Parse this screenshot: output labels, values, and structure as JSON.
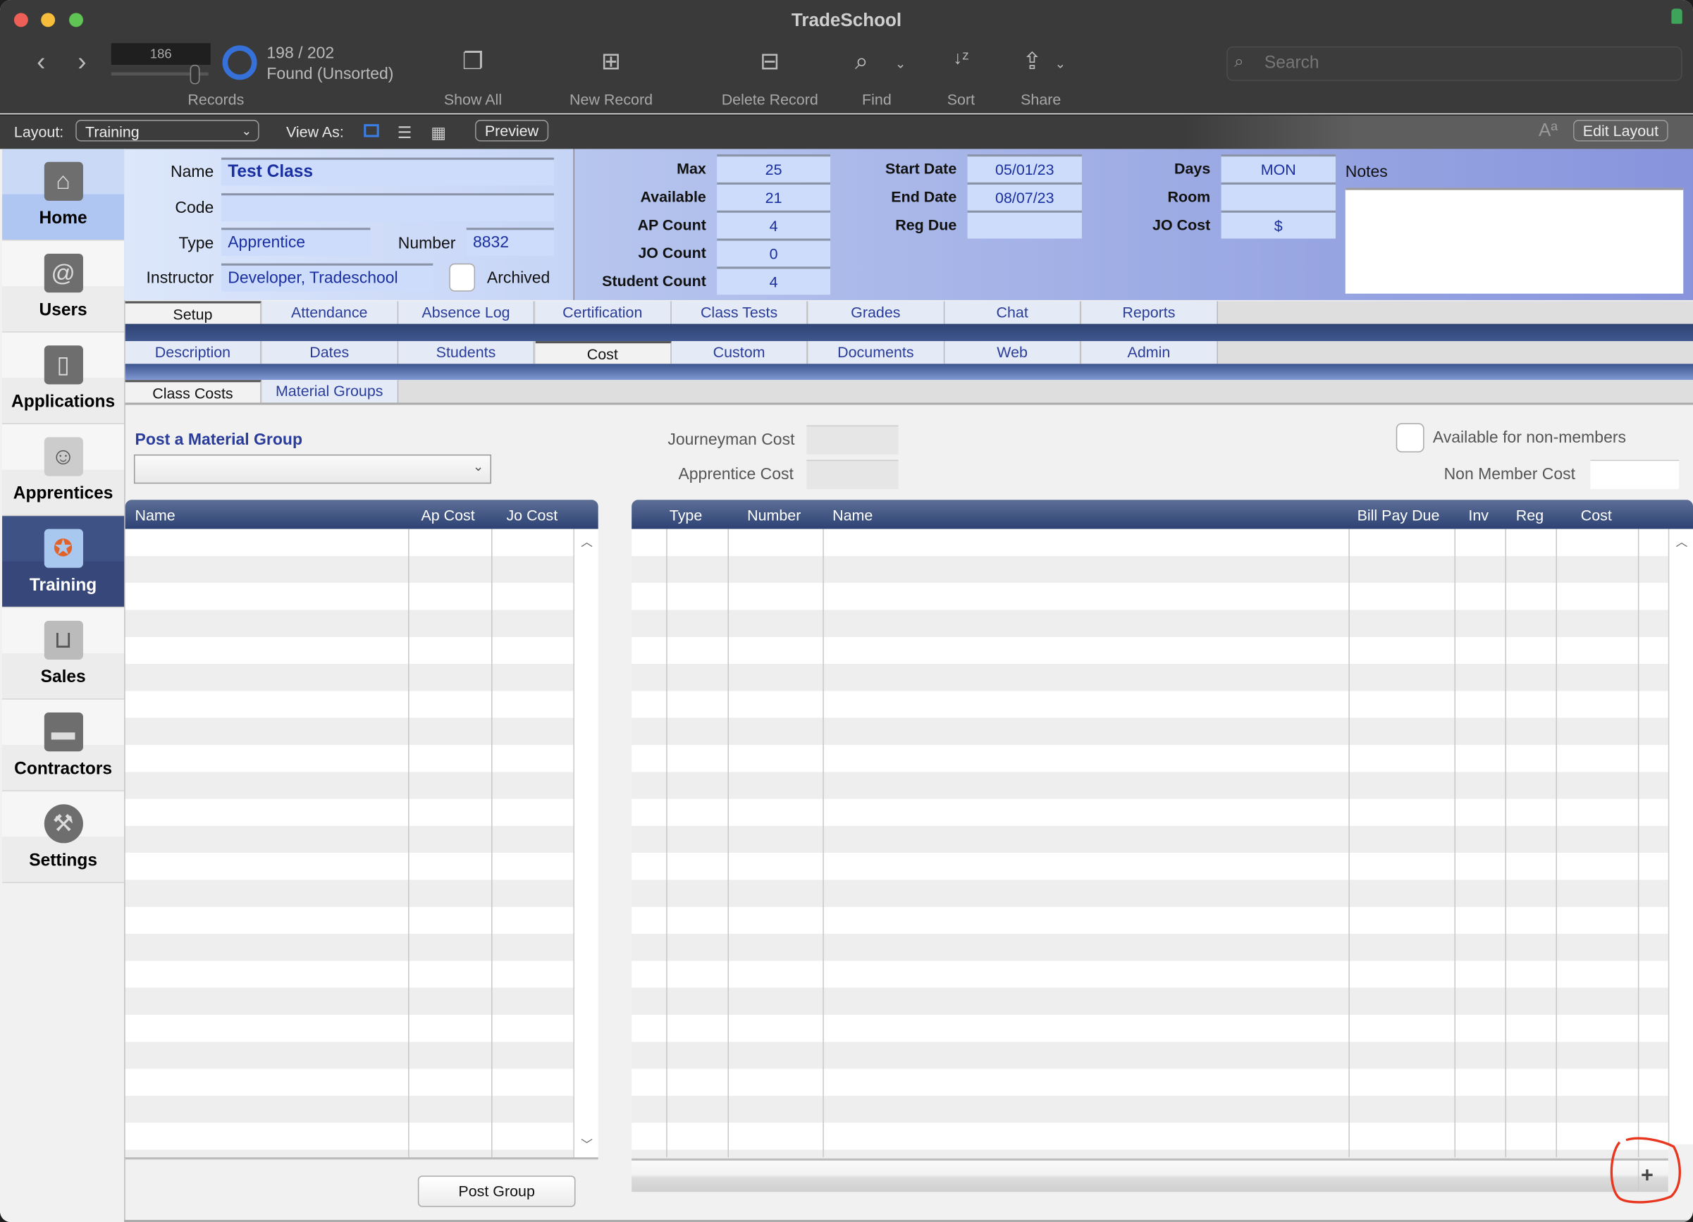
{
  "window": {
    "title": "TradeSchool"
  },
  "toolbar": {
    "record_number": "186",
    "found_count": "198 / 202",
    "found_status": "Found (Unsorted)",
    "records_label": "Records",
    "show_all": "Show All",
    "new_record": "New Record",
    "delete_record": "Delete Record",
    "find": "Find",
    "sort": "Sort",
    "share": "Share",
    "search_placeholder": "Search",
    "found_fraction": 0.98
  },
  "layoutbar": {
    "layout_label": "Layout:",
    "layout_value": "Training",
    "view_as_label": "View As:",
    "preview": "Preview",
    "edit_layout": "Edit Layout",
    "font_icon": "Aª"
  },
  "sidebar": {
    "items": [
      {
        "label": "Home",
        "icon": "house-icon"
      },
      {
        "label": "Users",
        "icon": "address-book-icon"
      },
      {
        "label": "Applications",
        "icon": "clipboard-icon"
      },
      {
        "label": "Apprentices",
        "icon": "id-badge-icon"
      },
      {
        "label": "Training",
        "icon": "certificate-icon"
      },
      {
        "label": "Sales",
        "icon": "basket-icon"
      },
      {
        "label": "Contractors",
        "icon": "briefcase-icon"
      },
      {
        "label": "Settings",
        "icon": "hammer-icon"
      }
    ],
    "active": "Training"
  },
  "record": {
    "name_label": "Name",
    "name": "Test Class",
    "code_label": "Code",
    "code": "",
    "type_label": "Type",
    "type": "Apprentice",
    "number_label": "Number",
    "number": "8832",
    "instructor_label": "Instructor",
    "instructor": "Developer, Tradeschool",
    "archived_label": "Archived",
    "max_label": "Max",
    "max": "25",
    "available_label": "Available",
    "available": "21",
    "ap_count_label": "AP Count",
    "ap_count": "4",
    "jo_count_label": "JO Count",
    "jo_count": "0",
    "student_count_label": "Student Count",
    "student_count": "4",
    "start_date_label": "Start Date",
    "start_date": "05/01/23",
    "end_date_label": "End Date",
    "end_date": "08/07/23",
    "reg_due_label": "Reg Due",
    "reg_due": "",
    "days_label": "Days",
    "days": "MON",
    "room_label": "Room",
    "room": "",
    "jo_cost_label": "JO Cost",
    "jo_cost": "$",
    "notes_label": "Notes"
  },
  "tabs1": [
    "Setup",
    "Attendance",
    "Absence Log",
    "Certification",
    "Class Tests",
    "Grades",
    "Chat",
    "Reports"
  ],
  "tabs2": [
    "Description",
    "Dates",
    "Students",
    "Cost",
    "Custom",
    "Documents",
    "Web",
    "Admin"
  ],
  "tabs3": [
    "Class Costs",
    "Material Groups"
  ],
  "cost": {
    "post_group_title": "Post a Material Group",
    "journeyman_cost_label": "Journeyman Cost",
    "apprentice_cost_label": "Apprentice Cost",
    "available_nonmembers_label": "Available for non-members",
    "non_member_cost_label": "Non Member Cost",
    "post_group_button": "Post Group",
    "left_table_columns": [
      "Name",
      "Ap Cost",
      "Jo Cost"
    ],
    "right_table_columns": [
      "Type",
      "Number",
      "Name",
      "Bill Pay Due",
      "Inv",
      "Reg",
      "Cost"
    ]
  },
  "colors": {
    "accent": "#2d4274",
    "active_sidebar": "#3a4d80",
    "field_text": "#1a2fa0",
    "annotation": "#e8361f"
  }
}
